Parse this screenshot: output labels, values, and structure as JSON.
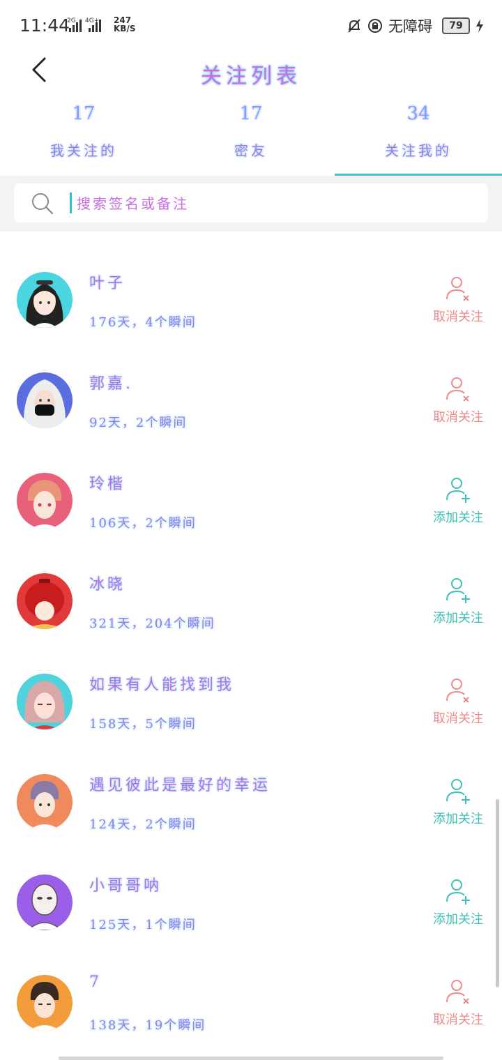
{
  "status_bar": {
    "time": "11:44",
    "net_speed_value": "247",
    "net_speed_unit": "KB/S",
    "accessibility_text": "无障碍",
    "battery": "79"
  },
  "header": {
    "title": "关注列表"
  },
  "tabs": [
    {
      "count": "17",
      "label": "我关注的",
      "active": false
    },
    {
      "count": "17",
      "label": "密友",
      "active": false
    },
    {
      "count": "34",
      "label": "关注我的",
      "active": true
    }
  ],
  "search": {
    "placeholder": "搜索签名或备注",
    "value": ""
  },
  "users": [
    {
      "name": "叶子",
      "meta": "176天，4个瞬间",
      "action": "取消关注",
      "action_type": "unfollow"
    },
    {
      "name": "郭嘉.",
      "meta": "92天，2个瞬间",
      "action": "取消关注",
      "action_type": "unfollow"
    },
    {
      "name": "玲楷",
      "meta": "106天，2个瞬间",
      "action": "添加关注",
      "action_type": "follow"
    },
    {
      "name": "冰晓",
      "meta": "321天，204个瞬间",
      "action": "添加关注",
      "action_type": "follow"
    },
    {
      "name": "如果有人能找到我",
      "meta": "158天，5个瞬间",
      "action": "取消关注",
      "action_type": "unfollow"
    },
    {
      "name": "遇见彼此是最好的幸运",
      "meta": "124天，2个瞬间",
      "action": "添加关注",
      "action_type": "follow"
    },
    {
      "name": "小哥哥呐",
      "meta": "125天，1个瞬间",
      "action": "添加关注",
      "action_type": "follow"
    },
    {
      "name": "7",
      "meta": "138天，19个瞬间",
      "action": "取消关注",
      "action_type": "unfollow"
    }
  ],
  "colors": {
    "accent": "#3ec9c9",
    "unfollow": "#ec8a8a",
    "follow": "#3ec0b8"
  }
}
